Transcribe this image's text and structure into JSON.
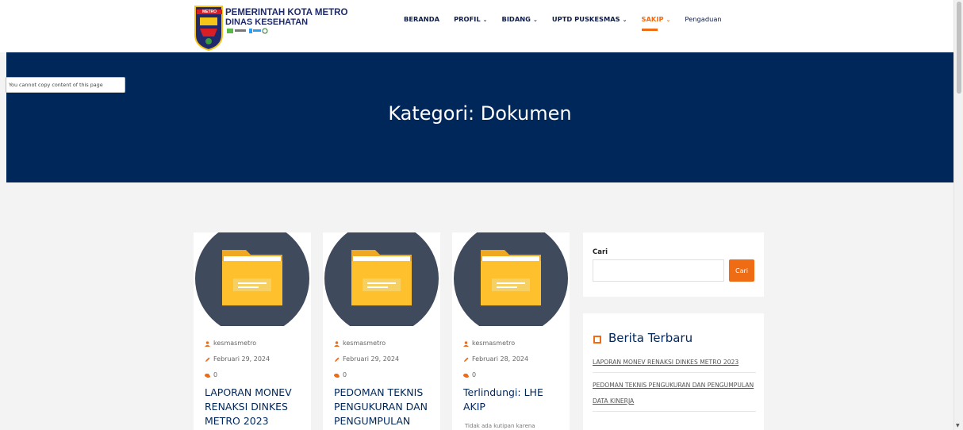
{
  "header": {
    "metro_tag": "METRO",
    "org_title": "PEMERINTAH KOTA METRO",
    "org_subtitle": "DINAS KESEHATAN"
  },
  "nav": {
    "items": [
      {
        "label": "BERANDA",
        "has_dropdown": false
      },
      {
        "label": "PROFIL",
        "has_dropdown": true
      },
      {
        "label": "BIDANG",
        "has_dropdown": true
      },
      {
        "label": "UPTD PUSKESMAS",
        "has_dropdown": true
      },
      {
        "label": "SAKIP",
        "has_dropdown": true,
        "active": true
      },
      {
        "label": "Pengaduan",
        "has_dropdown": false
      }
    ],
    "chevron": "⌄"
  },
  "hero": {
    "title": "Kategori: Dokumen"
  },
  "copy_notice": "You cannot copy content of this page",
  "posts": [
    {
      "author": "kesmasmetro",
      "date": "Februari 29, 2024",
      "comments": "0",
      "title": "LAPORAN MONEV RENAKSI DINKES METRO 2023",
      "excerpt": ""
    },
    {
      "author": "kesmasmetro",
      "date": "Februari 29, 2024",
      "comments": "0",
      "title": "PEDOMAN TEKNIS PENGUKURAN DAN PENGUMPULAN",
      "excerpt": ""
    },
    {
      "author": "kesmasmetro",
      "date": "Februari 28, 2024",
      "comments": "0",
      "title": "Terlindungi: LHE AKIP",
      "excerpt": "Tidak ada kutipan karena"
    }
  ],
  "sidebar": {
    "search": {
      "label": "Cari",
      "button": "Cari",
      "value": ""
    },
    "news": {
      "heading": "Berita Terbaru",
      "items": [
        "LAPORAN MONEV RENAKSI DINKES METRO 2023",
        "PEDOMAN TEKNIS PENGUKURAN DAN PENGUMPULAN DATA KINERJA"
      ]
    }
  },
  "colors": {
    "navy": "#00275a",
    "accent": "#ef6c14",
    "folder": "#fec02d",
    "thumb_circle": "#3f4a5c"
  }
}
